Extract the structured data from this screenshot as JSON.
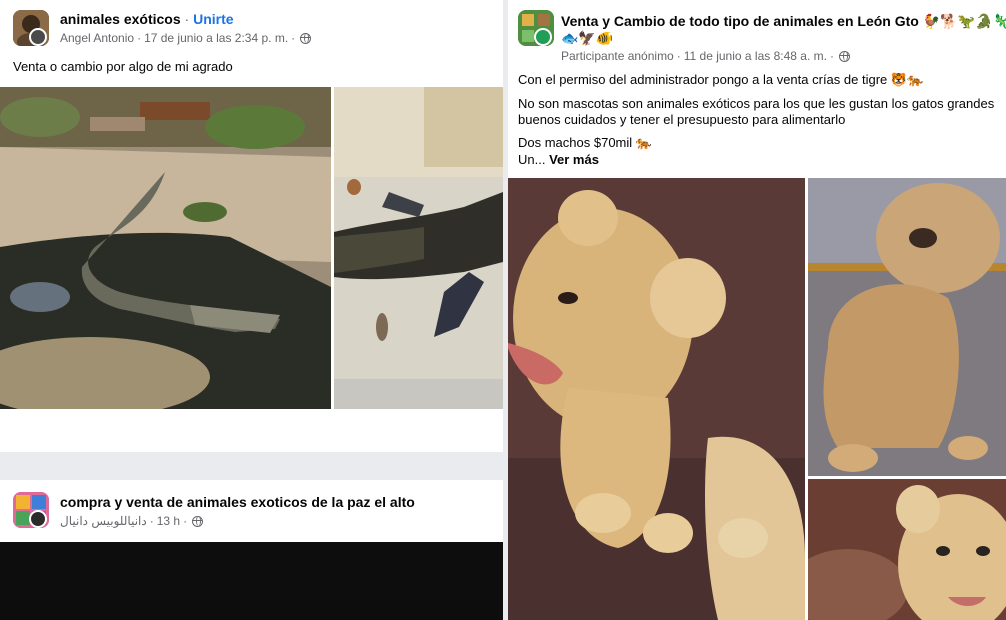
{
  "post1": {
    "group_name": "animales exóticos",
    "separator": " · ",
    "join_label": "Unirte",
    "author": "Angel Antonio",
    "meta_dot": "·",
    "timestamp": "17 de junio a las 2:34 p. m.",
    "meta_dot2": "·",
    "privacy_icon": "globe-icon",
    "text": "Venta o cambio por algo de mi agrado",
    "photos": [
      "crocodile-in-pond-photo",
      "crocodile-on-floor-photo"
    ]
  },
  "post2": {
    "group_name": "compra y venta de animales exoticos de la paz el alto",
    "author": "دانياللوبيس دانيال",
    "meta_dot": "·",
    "timestamp": "13 h",
    "meta_dot2": "·",
    "privacy_icon": "globe-icon"
  },
  "post3": {
    "group_name": "Venta y Cambio de todo tipo de animales en León Gto",
    "group_emojis": "🐓🐕🦖🐊🦎",
    "group_emojis_line2": "🐟🦅🐠",
    "author": "Participante anónimo",
    "meta_dot": "·",
    "timestamp": "11 de junio a las 8:48 a. m.",
    "meta_dot2": "·",
    "privacy_icon": "globe-icon",
    "line1": "Con el permiso del administrador pongo a la venta crías de tigre 🐯🐅",
    "line2": " No son mascotas son animales exóticos para los que les gustan los gatos grandes",
    "line3": "buenos cuidados y tener el presupuesto para alimentarlo",
    "line4": "Dos machos $70mil 🐅",
    "see_more_prefix": "Un... ",
    "see_more": "Ver más",
    "photos": [
      "lion-cub-roaring-photo",
      "lion-cub-sitting-photo",
      "lion-cub-face-photo"
    ]
  },
  "colors": {
    "link": "#1b74e4",
    "meta": "#65676b",
    "background": "#e9ebee"
  }
}
